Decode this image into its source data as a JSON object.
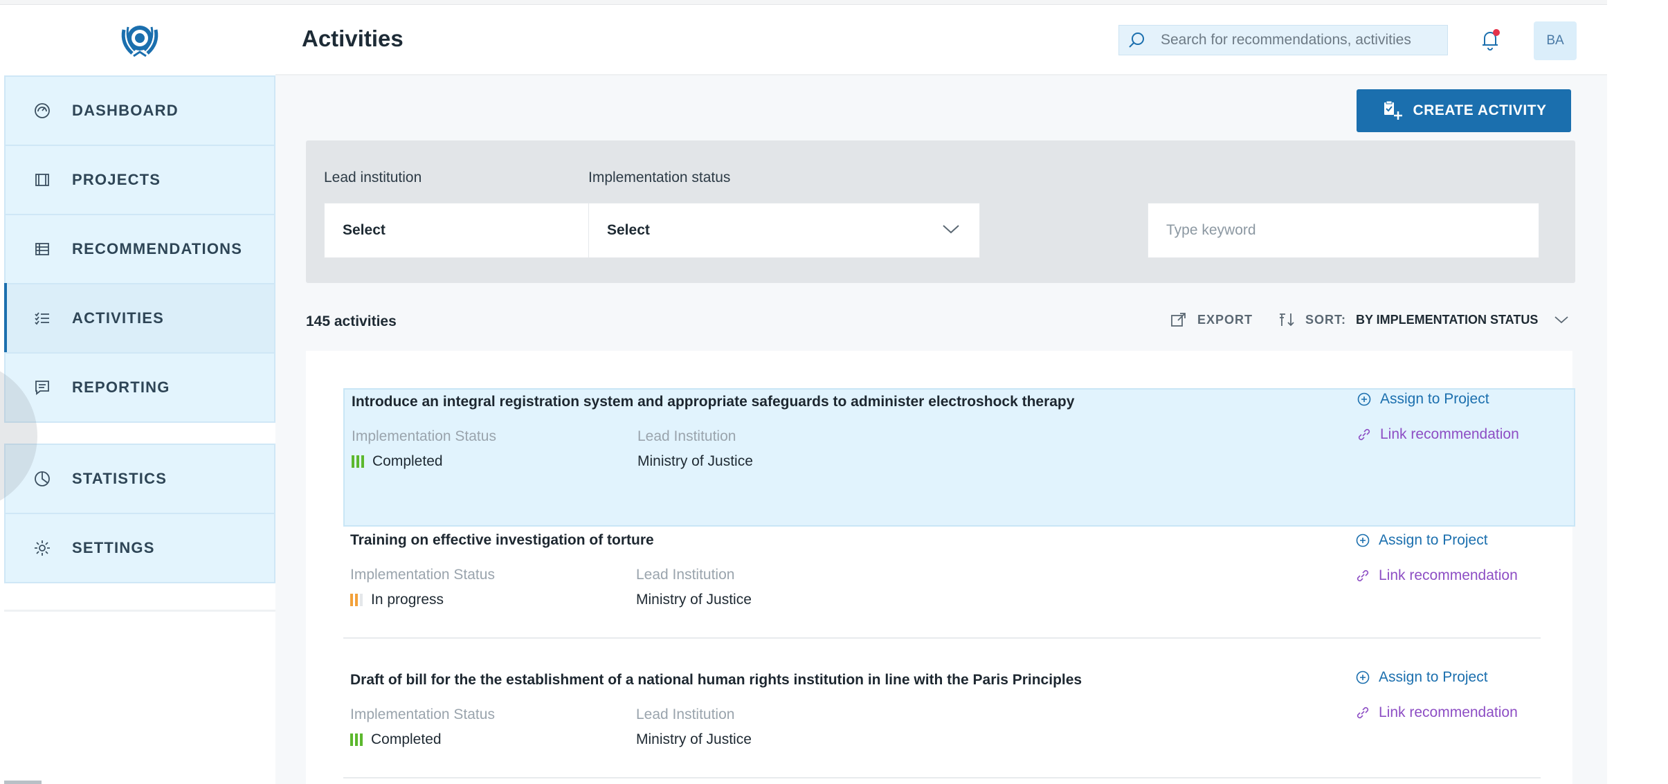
{
  "header": {
    "title": "Activities",
    "search_placeholder": "Search for recommendations, activities",
    "avatar_initials": "BA"
  },
  "sidebar": {
    "items": [
      {
        "label": "DASHBOARD",
        "icon": "dashboard-icon"
      },
      {
        "label": "PROJECTS",
        "icon": "projects-icon"
      },
      {
        "label": "RECOMMENDATIONS",
        "icon": "recommendations-icon"
      },
      {
        "label": "ACTIVITIES",
        "icon": "activities-icon",
        "active": true
      },
      {
        "label": "REPORTING",
        "icon": "reporting-icon"
      },
      {
        "label": "STATISTICS",
        "icon": "statistics-icon"
      },
      {
        "label": "SETTINGS",
        "icon": "settings-icon"
      }
    ]
  },
  "toolbar": {
    "create_label": "CREATE ACTIVITY"
  },
  "filters": {
    "lead_institution": {
      "label": "Lead institution",
      "value": "Select"
    },
    "implementation_status": {
      "label": "Implementation status",
      "value": "Select"
    },
    "keyword": {
      "placeholder": "Type keyword"
    }
  },
  "results": {
    "count_label": "145 activities",
    "export_label": "EXPORT",
    "sort_label": "SORT:",
    "sort_value": "BY IMPLEMENTATION STATUS"
  },
  "labels": {
    "implementation_status": "Implementation Status",
    "lead_institution": "Lead Institution",
    "assign": "Assign to Project",
    "link": "Link recommendation"
  },
  "activities": [
    {
      "title": "Introduce an integral registration system and appropriate safeguards to administer electroshock therapy",
      "status": "Completed",
      "status_level": 3,
      "status_color": "#5cb82e",
      "institution": "Ministry of Justice"
    },
    {
      "title": "Training on effective investigation of torture",
      "status": "In progress",
      "status_level": 2,
      "status_color": "#f2a13a",
      "institution": "Ministry of Justice"
    },
    {
      "title": "Draft of bill for the the establishment of a national human rights institution in line with the Paris Principles",
      "status": "Completed",
      "status_level": 3,
      "status_color": "#5cb82e",
      "institution": "Ministry of Justice"
    }
  ],
  "colors": {
    "accent": "#1b6fae",
    "link": "#8d4ec4",
    "sidebar_bg": "#e3f4fd",
    "highlight_bg": "#e1f3fd"
  }
}
